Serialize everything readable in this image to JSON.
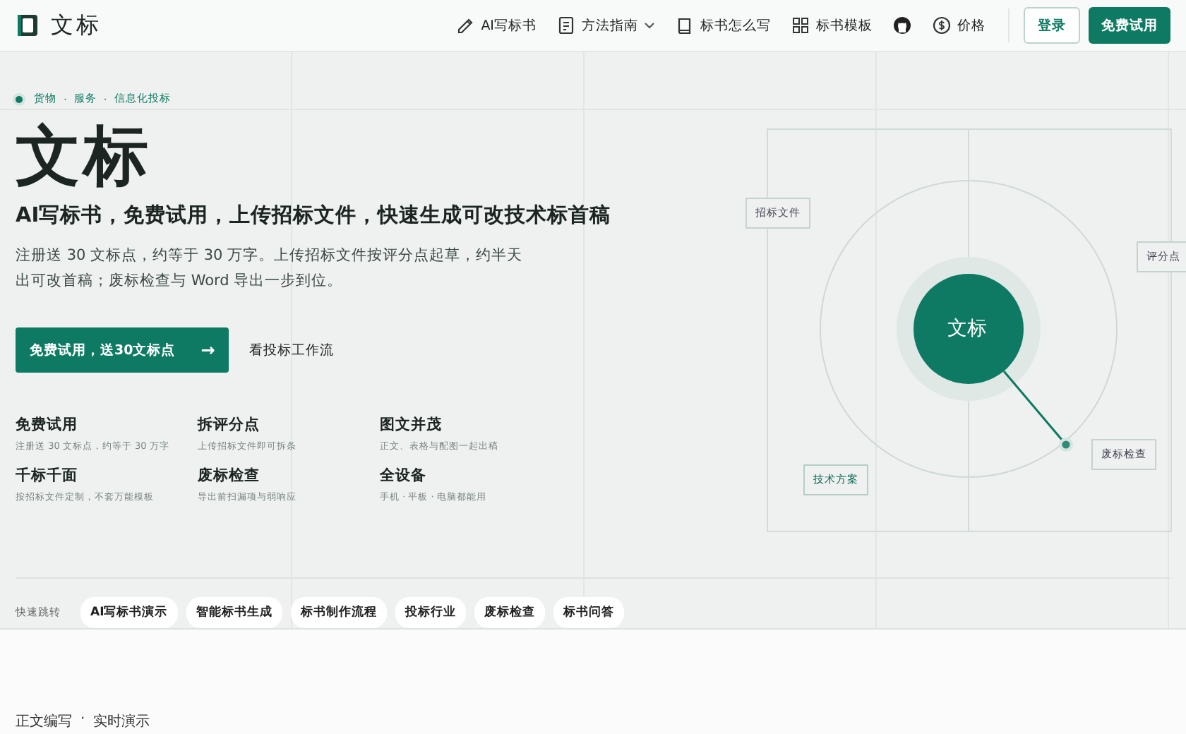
{
  "brand": {
    "name": "文标"
  },
  "nav": {
    "items": [
      {
        "kind": "text",
        "label": "AI写标书"
      },
      {
        "kind": "text",
        "label": "方法指南",
        "dropdown": true
      },
      {
        "kind": "text",
        "label": "标书怎么写"
      },
      {
        "kind": "text",
        "label": "标书模板"
      },
      {
        "kind": "icon"
      },
      {
        "kind": "text",
        "label": "价格"
      }
    ],
    "login": "登录",
    "cta": "免费试用"
  },
  "hero": {
    "breadcrumb": [
      "货物",
      "·",
      "服务",
      "·",
      "信息化投标"
    ],
    "title": "文标",
    "subtitle": "AI写标书，免费试用，上传招标文件，快速生成可改技术标首稿",
    "description": "注册送 30 文标点，约等于 30 万字。上传招标文件按评分点起草，约半天出可改首稿；废标检查与 Word 导出一步到位。",
    "primary_button": "免费试用，送30文标点",
    "primary_arrow": "→",
    "secondary_link": "看投标工作流",
    "features": [
      {
        "title": "免费试用",
        "text": "注册送 30 文标点，约等于 30 万字"
      },
      {
        "title": "拆评分点",
        "text": "上传招标文件即可拆条"
      },
      {
        "title": "图文并茂",
        "text": "正文、表格与配图一起出稿"
      },
      {
        "title": "千标千面",
        "text": "按招标文件定制，不套万能模板"
      },
      {
        "title": "废标检查",
        "text": "导出前扫漏项与弱响应"
      },
      {
        "title": "全设备",
        "text": "手机 · 平板 · 电脑都能用"
      }
    ],
    "quick_label": "快速跳转",
    "quick_links": [
      "AI写标书演示",
      "智能标书生成",
      "标书制作流程",
      "投标行业",
      "废标检查",
      "标书问答"
    ]
  },
  "diagram": {
    "center": "文标",
    "nodes": [
      "招标文件",
      "评分点",
      "技术方案",
      "废标检查"
    ]
  },
  "next_section": {
    "tags": [
      "正文编写",
      "·",
      "实时演示"
    ]
  }
}
